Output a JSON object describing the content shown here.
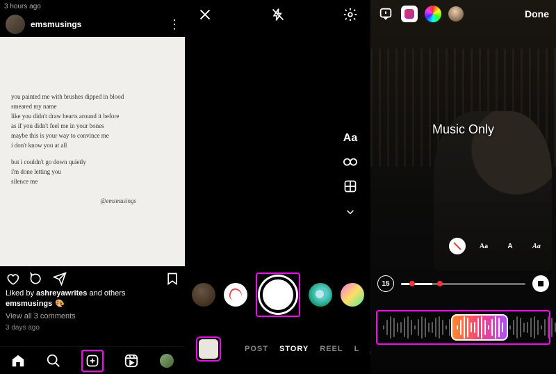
{
  "feed": {
    "top_time": "3 hours ago",
    "username": "emsmusings",
    "poem": {
      "l1": "you painted me with brushes dipped in blood",
      "l2": "smeared my name",
      "l3": "like you didn't draw hearts around it before",
      "l4": "as if you didn't feel me in your bones",
      "l5": "maybe this is your way to convince me",
      "l6": "i don't know you at all",
      "l7": "but i couldn't go down quietly",
      "l8": "i'm done letting you",
      "l9": "silence me",
      "sig": "@emsmusings"
    },
    "liked_prefix": "Liked by ",
    "liked_user": "ashreyawrites",
    "liked_suffix": " and others",
    "caption_user": "emsmusings",
    "view_comments": "View all 3 comments",
    "posted_ago": "3 days ago"
  },
  "camera": {
    "tool_text": "Aa",
    "mode_post": "POST",
    "mode_story": "STORY",
    "mode_reel": "REEL",
    "mode_live": "L"
  },
  "music": {
    "done": "Done",
    "label": "Music Only",
    "duration": "15",
    "style_aa1": "Aa",
    "style_aa2": "A",
    "style_aa3": "Aa"
  }
}
